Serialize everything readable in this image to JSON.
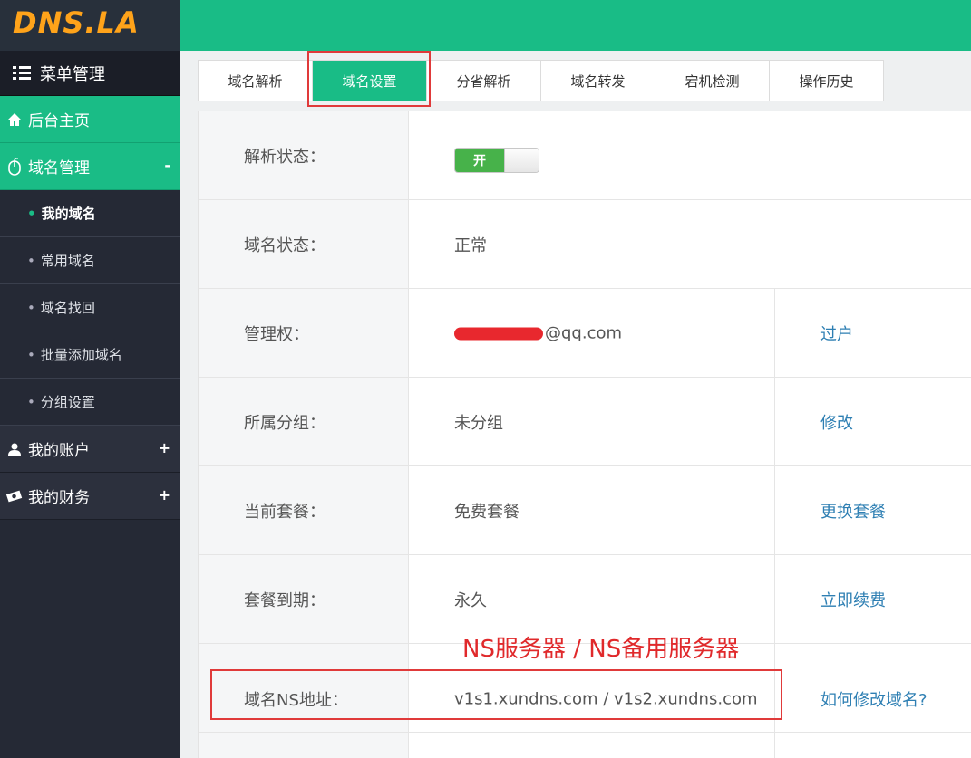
{
  "logo": {
    "text": "DNS.LA"
  },
  "sidebar": {
    "menu_header": "菜单管理",
    "items": [
      {
        "label": "后台主页",
        "icon": "home-icon"
      },
      {
        "label": "域名管理",
        "icon": "mouse-icon",
        "toggle": "-"
      },
      {
        "label": "我的账户",
        "icon": "user-icon",
        "toggle": "+"
      },
      {
        "label": "我的财务",
        "icon": "money-icon",
        "toggle": "+"
      }
    ],
    "sub_items": [
      {
        "label": "我的域名",
        "active": true
      },
      {
        "label": "常用域名"
      },
      {
        "label": "域名找回"
      },
      {
        "label": "批量添加域名"
      },
      {
        "label": "分组设置"
      }
    ],
    "bullet": "•"
  },
  "tabs": [
    {
      "label": "域名解析"
    },
    {
      "label": "域名设置",
      "active": true
    },
    {
      "label": "分省解析"
    },
    {
      "label": "域名转发"
    },
    {
      "label": "宕机检测"
    },
    {
      "label": "操作历史"
    }
  ],
  "settings": {
    "rows": [
      {
        "label": "解析状态：",
        "switch_label": "开",
        "switch_state": "on"
      },
      {
        "label": "域名状态：",
        "value": "正常"
      },
      {
        "label": "管理权：",
        "value": "@qq.com",
        "action": "过户"
      },
      {
        "label": "所属分组：",
        "value": "未分组",
        "action": "修改"
      },
      {
        "label": "当前套餐：",
        "value": "免费套餐",
        "action": "更换套餐"
      },
      {
        "label": "套餐到期：",
        "value": "永久",
        "action": "立即续费"
      },
      {
        "label": "域名NS地址：",
        "value": "v1s1.xundns.com / v1s2.xundns.com",
        "action": "如何修改域名?"
      }
    ]
  },
  "annotation": {
    "ns_text": "NS服务器  / NS备用服务器"
  },
  "colors": {
    "brand_green": "#19bc86",
    "sidebar_bg": "#252935",
    "highlight_red": "#e03a3a",
    "link_blue": "#2e7fb3",
    "logo_orange": "#ffa31a"
  }
}
